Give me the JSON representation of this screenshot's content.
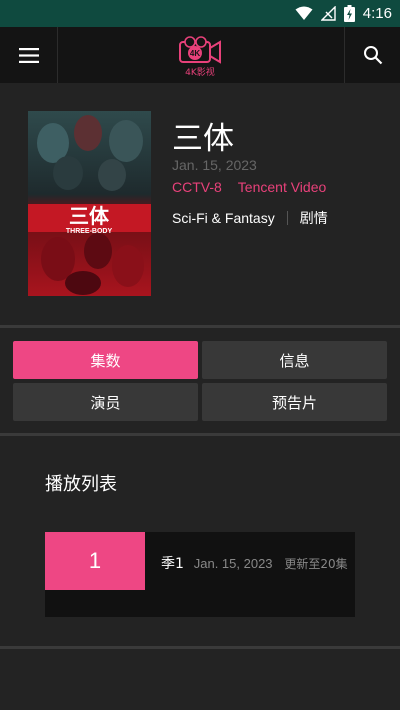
{
  "status_bar": {
    "time": "4:16",
    "icons": [
      "wifi-icon",
      "signal-off-icon",
      "battery-charging-icon"
    ]
  },
  "header": {
    "logo_text": "4K影视",
    "logo_badge": "4K",
    "menu_icon": "menu-icon",
    "search_icon": "search-icon"
  },
  "show": {
    "title": "三体",
    "date": "Jan. 15, 2023",
    "networks": [
      "CCTV-8",
      "Tencent Video"
    ],
    "genres": [
      "Sci-Fi & Fantasy",
      "剧情"
    ],
    "poster": {
      "title": "三体",
      "subtitle": "THREE-BODY"
    }
  },
  "tabs": [
    {
      "label": "集数",
      "active": true
    },
    {
      "label": "信息",
      "active": false
    },
    {
      "label": "演员",
      "active": false
    },
    {
      "label": "预告片",
      "active": false
    }
  ],
  "playlist": {
    "title": "播放列表",
    "episodes": [
      {
        "number": "1",
        "season": "季1",
        "date": "Jan. 15, 2023",
        "status": "更新至20集"
      }
    ]
  },
  "colors": {
    "accent": "#ee4784",
    "status_bar": "#0f4a3f",
    "header": "#141414",
    "panel": "#232323"
  }
}
